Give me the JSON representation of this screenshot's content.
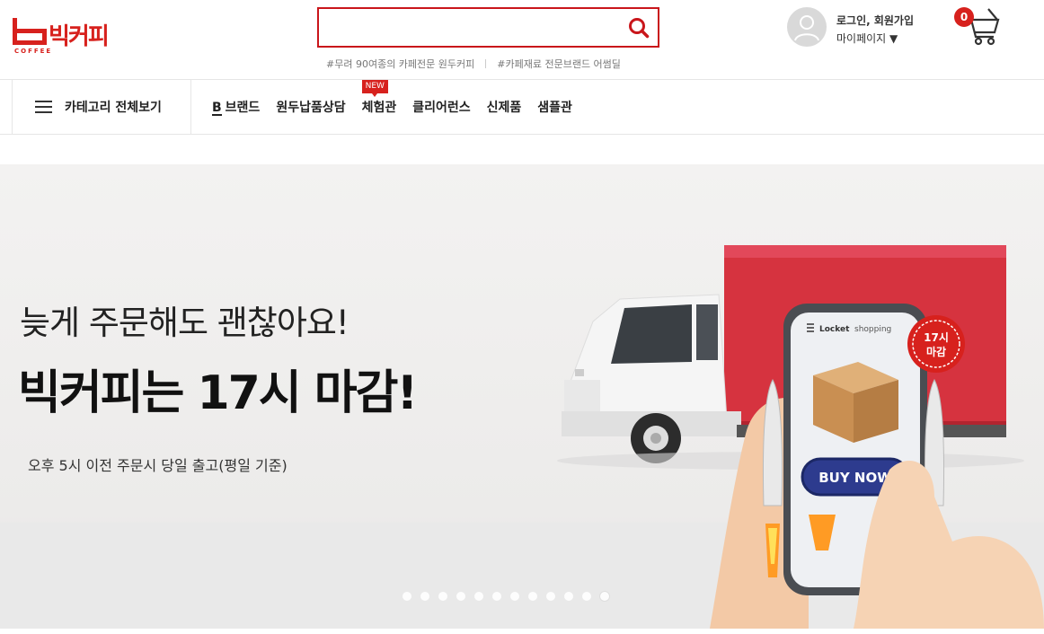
{
  "brand": {
    "logo_text": "빅커피",
    "logo_sub": "COFFEE",
    "accent_color": "#d7211d"
  },
  "search": {
    "placeholder": "",
    "icon": "search-icon",
    "tags": [
      "#무려 90여종의 카페전문 원두커피",
      "#카페재료 전문브랜드 어썸딜"
    ]
  },
  "user": {
    "login_label": "로그인, 회원가입",
    "mypage_label": "마이페이지 ▼",
    "avatar_icon": "user-avatar-icon"
  },
  "cart": {
    "count": "0",
    "icon": "cart-icon"
  },
  "nav": {
    "category_all": "카테고리 전체보기",
    "items": [
      {
        "prefix": "B",
        "label": "브랜드"
      },
      {
        "label": "원두납품상담"
      },
      {
        "label": "체험관",
        "badge": "NEW"
      },
      {
        "label": "클리어런스"
      },
      {
        "label": "신제품"
      },
      {
        "label": "샘플관"
      }
    ]
  },
  "banner": {
    "headline1": "늦게 주문해도 괜찮아요!",
    "headline2": "빅커피는 17시 마감!",
    "subline": "오후 5시 이전 주문시 당일 출고(평일 기준)",
    "phone_app_label": "Locket",
    "phone_app_sub": "shopping",
    "buy_now": "BUY NOW",
    "deadline_badge_line1": "17시",
    "deadline_badge_line2": "마감",
    "slide_count": 12,
    "active_slide": 12
  }
}
